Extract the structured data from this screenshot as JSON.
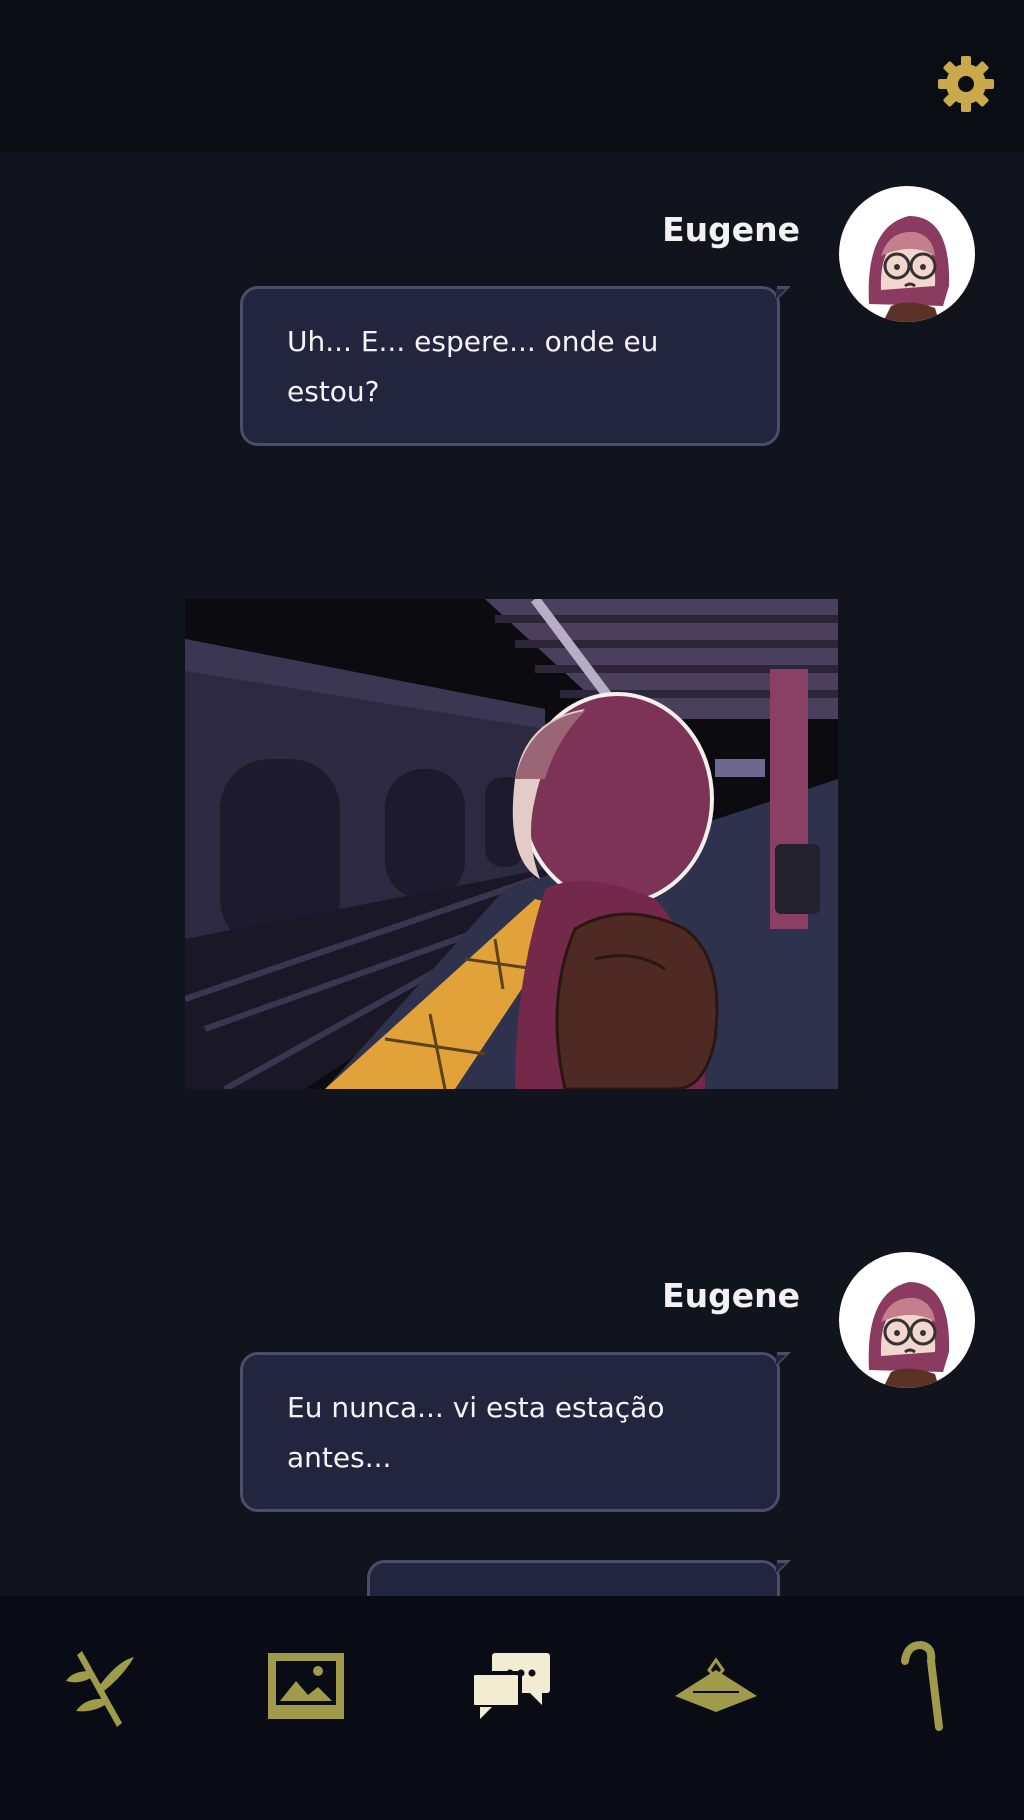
{
  "top_bar": {
    "settings_icon": "gear-icon"
  },
  "colors": {
    "accent_gold": "#c9a94a",
    "icon_olive": "#a09b4a",
    "bubble_bg": "#22253d",
    "bubble_border": "#4a4e68",
    "active_icon": "#f1ecd2"
  },
  "messages": [
    {
      "speaker": "Eugene",
      "text_line1": "Uh... E... espere... onde eu",
      "text_line2": "estou?"
    },
    {
      "type": "image",
      "description_icon": "subway-platform-image"
    },
    {
      "speaker": "Eugene",
      "text_line1": "Eu nunca... vi esta estação",
      "text_line2": "antes..."
    },
    {
      "speaker": "",
      "text_line1": "",
      "text_line2": ""
    }
  ],
  "bottom_nav": [
    {
      "icon": "branch-icon",
      "active": false
    },
    {
      "icon": "gallery-icon",
      "active": false
    },
    {
      "icon": "chat-icon",
      "active": true
    },
    {
      "icon": "hat-icon",
      "active": false
    },
    {
      "icon": "cane-icon",
      "active": false
    }
  ]
}
